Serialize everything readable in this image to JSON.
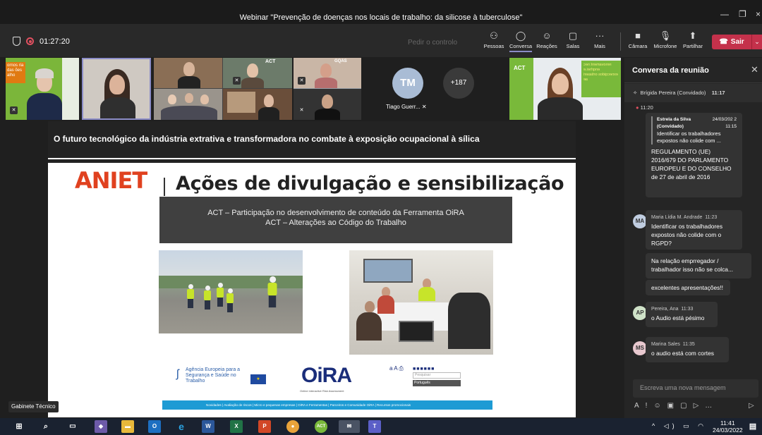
{
  "window": {
    "title": "Webinar \"Prevenção de doenças nos locais de trabalho: da silicose à tuberculose\""
  },
  "toolbar": {
    "timer": "01:27:20",
    "request_control": "Pedir o controlo",
    "people_label": "Pessoas",
    "chat_label": "Conversa",
    "reactions_label": "Reações",
    "rooms_label": "Salas",
    "more_label": "Mais",
    "camera_label": "Câmara",
    "mic_label": "Microfone",
    "share_label": "Partilhar",
    "leave_label": "Sair"
  },
  "participants": {
    "tm_initials": "TM",
    "tm_name": "Tiago Guerr...",
    "overflow_count": "+187",
    "tile1_text": "ornos ria das ões alho",
    "tile_act": "ACT",
    "tile_gqas": "GQAS",
    "right_tile_text": "renovament nec enqrhei.e exnecqidos ortiaseri ae"
  },
  "slide": {
    "header_title": "O futuro tecnológico da indústria extrativa e transformadora no combate à exposição ocupacional à sílica",
    "logo": "ANIET",
    "heading": "Ações de divulgação e sensibilização",
    "box_line1": "ACT – Participação no desenvolvimento de conteúdo da Ferramenta OiRA",
    "box_line2": "ACT – Alterações ao Código do Trabalho",
    "agency_text": "Agência Europeia para a Segurança e Saúde no Trabalho",
    "oira": "OiRA",
    "oira_sub": "Online interactive Risk Assessment",
    "lang_search": "Pesquisar",
    "lang_select": "Português",
    "footer_bar": "Novidades  |  Avaliação de riscos  |  Micro e pequenas empresas  |  OiRA e Ferramentas  |  Parceiros e Comunidade OiRA  |  Recursos promocionais",
    "presenter": "Gabinete Técnico"
  },
  "chat": {
    "title": "Conversa da reunião",
    "pinned_name": "Brígida Pereira (Convidado)",
    "pinned_time": "11:17",
    "first_time": "11:20",
    "quote_name": "Estrela da Silva (Convidado)",
    "quote_date": "24/03/202 2 11:15",
    "quote_text": "Identificar os trabalhadores expostos não colide com ...",
    "msg1": "REGULAMENTO (UE) 2016/679 DO PARLAMENTO EUROPEU E DO CONSELHO de 27 de abril de 2016",
    "msg2_author": "Maria Lídia M. Andrade",
    "msg2_time": "11:23",
    "msg2_initials": "MA",
    "msg2_text": "Identificar os trabalhadores expostos não colide com o RGPD?",
    "msg3_text": "Na relação emprregador / trabalhador isso não se colca...",
    "msg4_text": "excelentes apresentações!!",
    "msg5_author": "Pereira, Ana",
    "msg5_time": "11:33",
    "msg5_initials": "AP",
    "msg5_text": "o Audio está pésimo",
    "msg6_author": "Marina Sales",
    "msg6_time": "11:35",
    "msg6_initials": "MS",
    "msg6_text": "o audio está com cortes",
    "compose_placeholder": "Escreva uma nova mensagem"
  },
  "taskbar": {
    "time": "11:41",
    "date": "24/03/2022",
    "act_label": "ACT"
  },
  "colors": {
    "leave": "#c4314b",
    "accent": "#8b8cc7",
    "aniet": "#e0411f",
    "oira_bar": "#1d9bd4"
  }
}
